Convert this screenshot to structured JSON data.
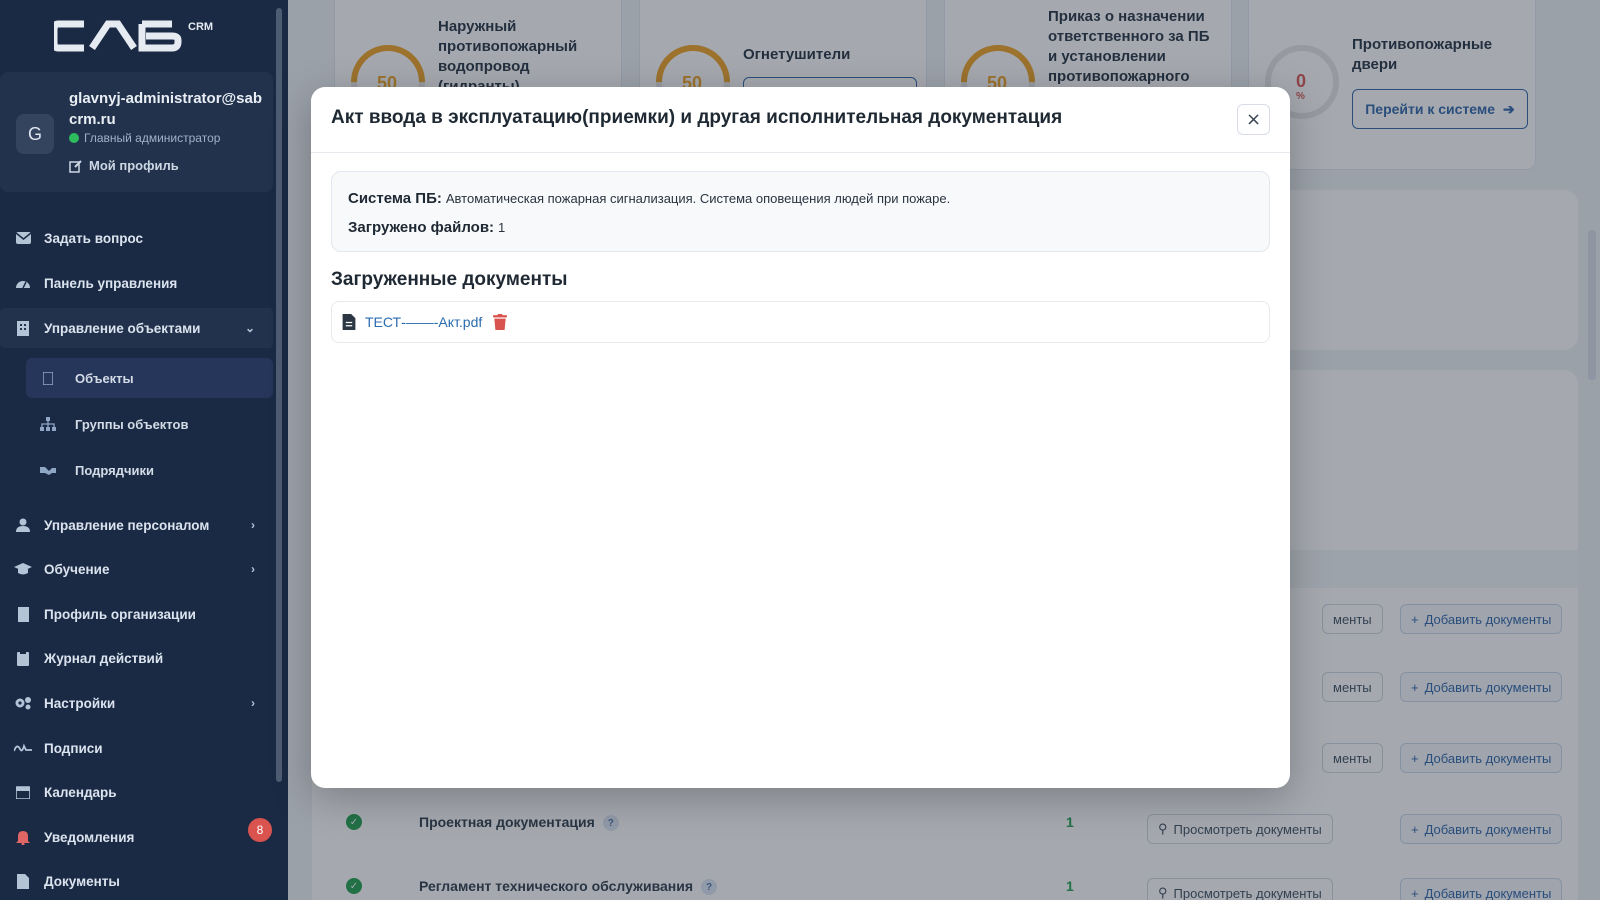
{
  "sidebar": {
    "logo_text": "CRM",
    "profile": {
      "avatar_letter": "G",
      "email": "glavnyj-administrator@sabcrm.ru",
      "role": "Главный администратор",
      "profile_link": "Мой профиль"
    },
    "nav": {
      "ask": "Задать вопрос",
      "dashboard": "Панель управления",
      "objects_mgmt": "Управление объектами",
      "objects": "Объекты",
      "object_groups": "Группы объектов",
      "contractors": "Подрядчики",
      "staff": "Управление персоналом",
      "training": "Обучение",
      "org_profile": "Профиль организации",
      "action_log": "Журнал действий",
      "settings": "Настройки",
      "signatures": "Подписи",
      "calendar": "Календарь",
      "notifications": "Уведомления",
      "notifications_badge": "8",
      "documents": "Документы"
    }
  },
  "background": {
    "cards": [
      {
        "title": "Наружный противопожарный водопровод (гидранты)",
        "percent": "50"
      },
      {
        "title": "Огнетушители",
        "percent": "50"
      },
      {
        "title": "Приказ о назначении ответственного за ПБ и установлении противопожарного",
        "percent": "50"
      },
      {
        "title": "Противопожарные двери",
        "percent": "0",
        "percent_sign": "%",
        "button": "Перейти к системе"
      }
    ],
    "rows": [
      {
        "view": "менты",
        "add": "Добавить документы"
      },
      {
        "view": "менты",
        "add": "Добавить документы"
      },
      {
        "view": "менты",
        "add": "Добавить документы"
      },
      {
        "name": "Проектная документация",
        "count": "1",
        "view": "Просмотреть документы",
        "add": "Добавить документы"
      },
      {
        "name": "Регламент технического обслуживания",
        "count": "1",
        "view": "Просмотреть документы",
        "add": "Добавить документы"
      }
    ]
  },
  "modal": {
    "title": "Акт ввода в эксплуатацию(приемки) и другая исполнительная документация",
    "close": "×",
    "system_label": "Система ПБ:",
    "system_value": "Автоматическая пожарная сигнализация. Система оповещения людей при пожаре.",
    "files_label": "Загружено файлов:",
    "files_value": "1",
    "docs_heading": "Загруженные документы",
    "files": [
      {
        "name": "ТЕСТ-——-Акт.pdf"
      }
    ]
  },
  "colors": {
    "sidebar_bg": "#1a2a44",
    "accent": "#2b62a8",
    "warning": "#f0a020",
    "danger": "#d9534f",
    "success": "#1e9e4a"
  }
}
